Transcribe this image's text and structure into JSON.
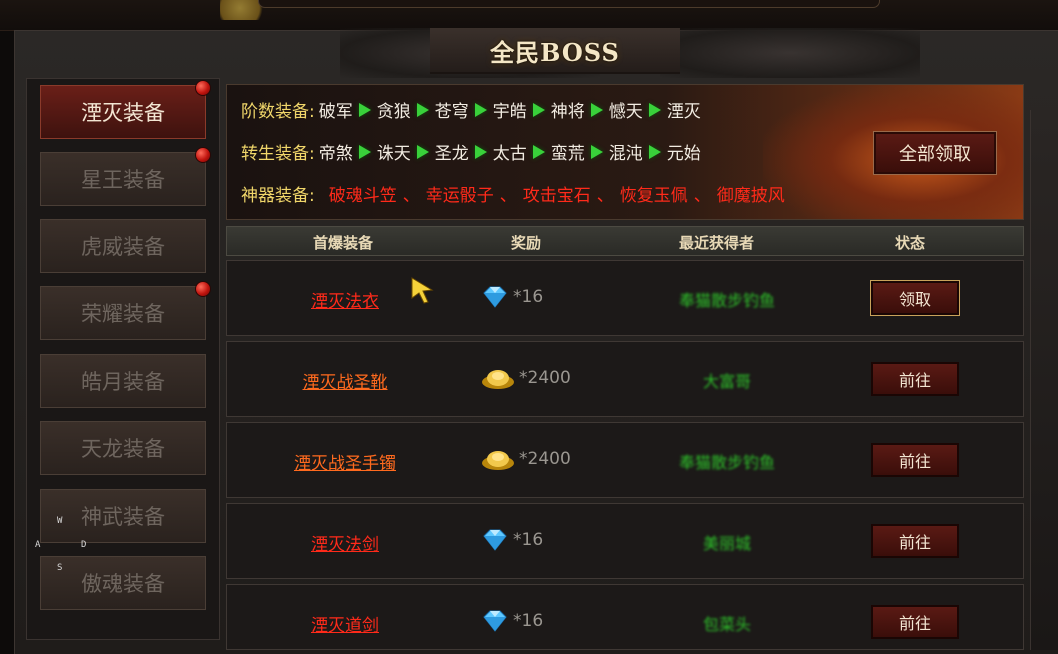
{
  "title": "全民BOSS",
  "menu": [
    {
      "label": "湮灭装备",
      "active": true,
      "dot": true
    },
    {
      "label": "星王装备",
      "active": false,
      "dot": true
    },
    {
      "label": "虎威装备",
      "active": false,
      "dot": false
    },
    {
      "label": "荣耀装备",
      "active": false,
      "dot": true
    },
    {
      "label": "皓月装备",
      "active": false,
      "dot": false
    },
    {
      "label": "天龙装备",
      "active": false,
      "dot": false
    },
    {
      "label": "神武装备",
      "active": false,
      "dot": false
    },
    {
      "label": "傲魂装备",
      "active": false,
      "dot": false
    }
  ],
  "keys": {
    "w": "W",
    "a": "A",
    "d": "D",
    "s": "S"
  },
  "banner": {
    "tier_label": "阶数装备:",
    "tier_items": [
      "破军",
      "贪狼",
      "苍穹",
      "宇皓",
      "神将",
      "憾天",
      "湮灭"
    ],
    "rebirth_label": "转生装备:",
    "rebirth_items": [
      "帝煞",
      "诛天",
      "圣龙",
      "太古",
      "蛮荒",
      "混沌",
      "元始"
    ],
    "artifact_label": "神器装备:",
    "artifact_items": [
      "破魂斗笠",
      "幸运骰子",
      "攻击宝石",
      "恢复玉佩",
      "御魔披风"
    ],
    "artifact_sep": "、",
    "claim_all": "全部领取"
  },
  "table": {
    "headers": [
      "首爆装备",
      "奖励",
      "最近获得者",
      "状态"
    ],
    "rows": [
      {
        "equip": "湮灭法衣",
        "equip_color": "red",
        "reward_icon": "diamond-icon",
        "qty": "*16",
        "winner": "奉猫散步钓鱼",
        "action": "领取",
        "highlight": true
      },
      {
        "equip": "湮灭战圣靴",
        "equip_color": "orange",
        "reward_icon": "gold-ingot-icon",
        "qty": "*2400",
        "winner": "大富哥",
        "action": "前往",
        "highlight": false
      },
      {
        "equip": "湮灭战圣手镯",
        "equip_color": "orange",
        "reward_icon": "gold-ingot-icon",
        "qty": "*2400",
        "winner": "奉猫散步钓鱼",
        "action": "前往",
        "highlight": false
      },
      {
        "equip": "湮灭法剑",
        "equip_color": "red",
        "reward_icon": "diamond-icon",
        "qty": "*16",
        "winner": "美丽城",
        "action": "前往",
        "highlight": false
      },
      {
        "equip": "湮灭道剑",
        "equip_color": "red",
        "reward_icon": "diamond-icon",
        "qty": "*16",
        "winner": "包菜头",
        "action": "前往",
        "highlight": false
      }
    ]
  }
}
